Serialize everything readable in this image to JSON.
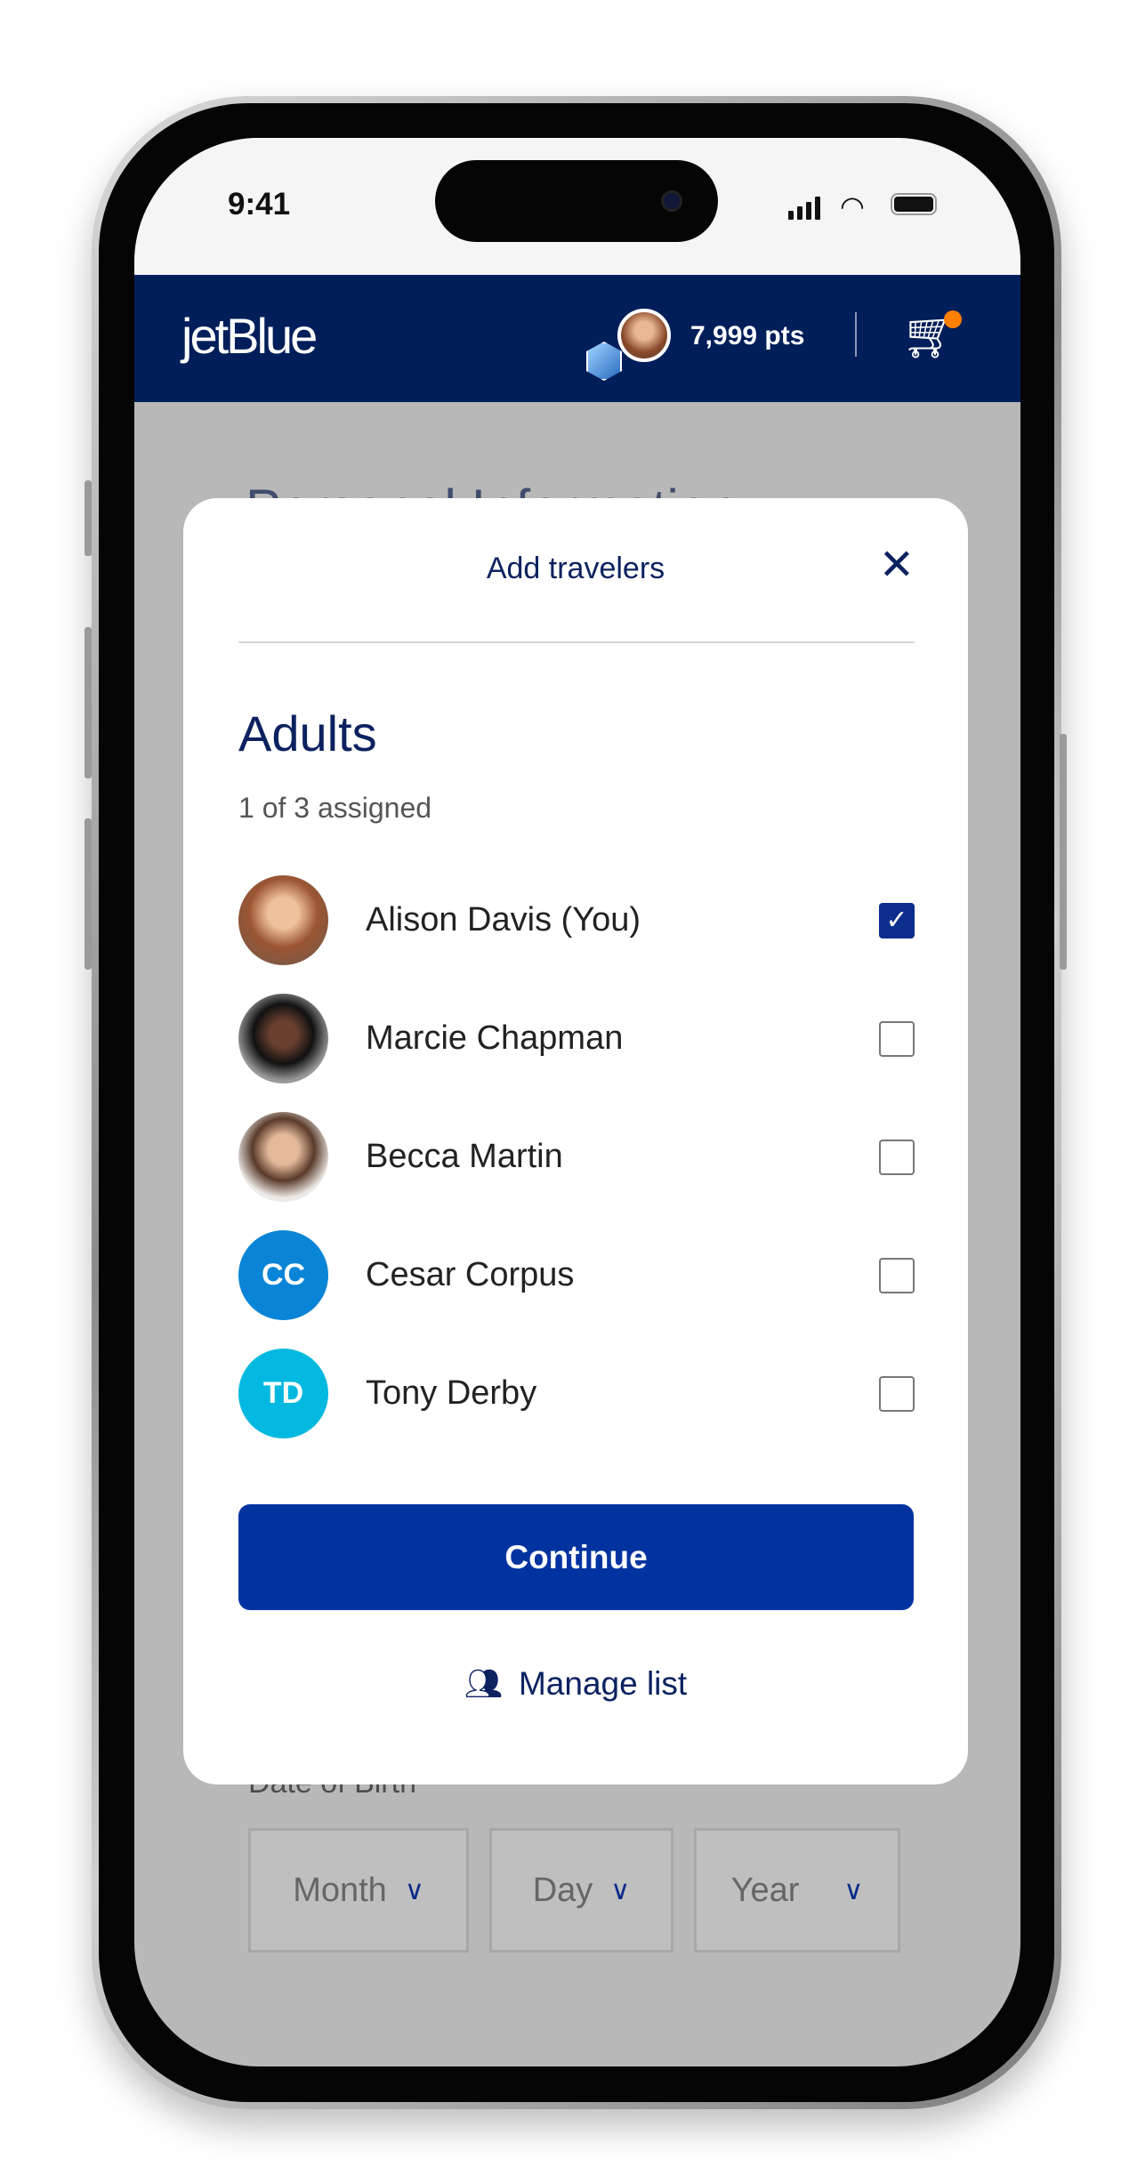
{
  "status_bar": {
    "time": "9:41"
  },
  "header": {
    "logo": "jetBlue",
    "points": "7,999 pts",
    "cart_badge_color": "#ff7f00",
    "brand_color": "#001e59"
  },
  "background_page": {
    "title": "Personal Information",
    "dob_label": "Date of Birth",
    "selects": [
      {
        "label": "Month"
      },
      {
        "label": "Day"
      },
      {
        "label": "Year"
      }
    ]
  },
  "modal": {
    "title": "Add travelers",
    "section": "Adults",
    "assigned": "1 of 3 assigned",
    "travelers": [
      {
        "name": "Alison Davis (You)",
        "initials": "",
        "photo": true,
        "checked": true
      },
      {
        "name": "Marcie Chapman",
        "initials": "",
        "photo": true,
        "checked": false
      },
      {
        "name": "Becca Martin",
        "initials": "",
        "photo": true,
        "checked": false
      },
      {
        "name": "Cesar Corpus",
        "initials": "CC",
        "photo": false,
        "color": "#0a84d6",
        "checked": false
      },
      {
        "name": "Tony Derby",
        "initials": "TD",
        "photo": false,
        "color": "#00b8e0",
        "checked": false
      }
    ],
    "continue_label": "Continue",
    "manage_label": "Manage list",
    "button_color": "#0033a0"
  }
}
